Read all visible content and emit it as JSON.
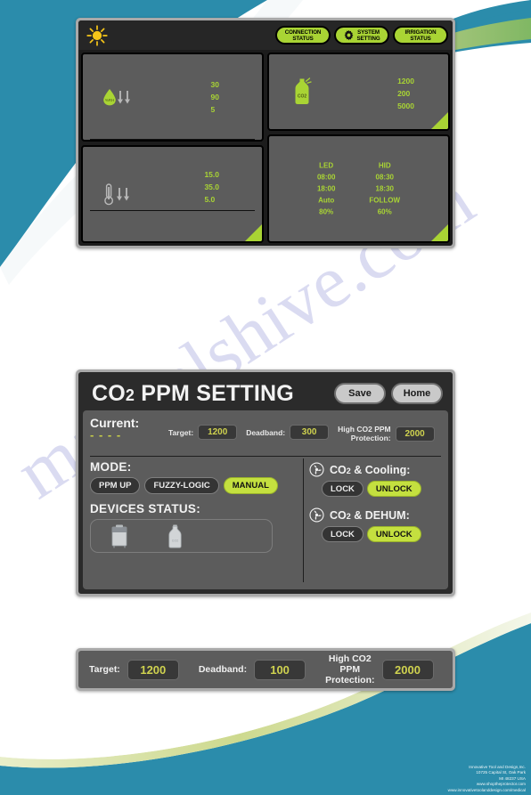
{
  "theme": {
    "teal": "#2b8cab",
    "accent_green": "#a9d434",
    "panel_grey": "#5c5c5c",
    "bezel_grey": "#a9a9a9",
    "screen_black": "#1c1c1c",
    "value_yellow": "#cfd24f",
    "sun_yellow": "#f5c518"
  },
  "watermark": {
    "line1": "manualshive.com",
    "line2": "CO2"
  },
  "dashboard": {
    "topbar": {
      "sun_icon": "sun-icon",
      "buttons": [
        {
          "icon": "",
          "label_line1": "CONNECTION",
          "label_line2": "STATUS",
          "name": "connection-status-button"
        },
        {
          "icon": "gear-icon",
          "label_line1": "SYSTEM",
          "label_line2": "SETTING",
          "name": "system-setting-button"
        },
        {
          "icon": "",
          "label_line1": "IRRIGATION",
          "label_line2": "STATUS",
          "name": "irrigation-status-button"
        }
      ]
    },
    "humidity_panel": {
      "icon": "humidity-droplet-icon",
      "values": [
        "30",
        "90",
        "5"
      ]
    },
    "temperature_panel": {
      "icon": "thermometer-icon",
      "values": [
        "15.0",
        "35.0",
        "5.0"
      ]
    },
    "co2_panel": {
      "icon": "co2-spray-bottle-icon",
      "icon_label": "CO2",
      "values": [
        "1200",
        "200",
        "5000"
      ]
    },
    "lighting_panel": {
      "columns": [
        {
          "header": "LED",
          "on_time": "08:00",
          "off_time": "18:00",
          "mode": "Auto",
          "level": "80%"
        },
        {
          "header": "HID",
          "on_time": "08:30",
          "off_time": "18:30",
          "mode": "FOLLOW",
          "level": "60%"
        }
      ]
    }
  },
  "co2_setting": {
    "title_main": "CO",
    "title_sub": "2",
    "title_rest": " PPM SETTING",
    "save_label": "Save",
    "home_label": "Home",
    "current_label": "Current:",
    "current_value": "- - - -",
    "fields": [
      {
        "label": "Target:",
        "value": "1200",
        "name": "target-field"
      },
      {
        "label": "Deadband:",
        "value": "300",
        "name": "deadband-field"
      },
      {
        "label_line1": "High CO2 PPM",
        "label_line2": "Protection:",
        "value": "2000",
        "name": "high-co2-protection-field"
      }
    ],
    "mode_label": "MODE:",
    "modes": [
      {
        "label": "PPM UP",
        "active": false,
        "name": "mode-ppm-up-button"
      },
      {
        "label": "FUZZY-LOGIC",
        "active": false,
        "name": "mode-fuzzy-logic-button"
      },
      {
        "label": "MANUAL",
        "active": true,
        "name": "mode-manual-button"
      }
    ],
    "devices_label": "DEVICES  STATUS:",
    "devices": [
      {
        "icon": "co2-burner-icon",
        "name": "device-status-burner"
      },
      {
        "icon": "co2-tank-icon",
        "name": "device-status-tank"
      }
    ],
    "controls": [
      {
        "icon": "fan-icon",
        "title_main": "CO",
        "title_sub": "2",
        "title_rest": " & Cooling:",
        "lock_label": "LOCK",
        "unlock_label": "UNLOCK",
        "state": "UNLOCK",
        "name": "co2-cooling-control"
      },
      {
        "icon": "fan-icon",
        "title_main": "CO",
        "title_sub": "2",
        "title_rest": " & DEHUM:",
        "lock_label": "LOCK",
        "unlock_label": "UNLOCK",
        "state": "UNLOCK",
        "name": "co2-dehum-control"
      }
    ]
  },
  "bottom_strip": {
    "fields": [
      {
        "label": "Target:",
        "value": "1200",
        "name": "strip-target-field"
      },
      {
        "label": "Deadband:",
        "value": "100",
        "name": "strip-deadband-field"
      },
      {
        "label_line1": "High CO2 PPM",
        "label_line2": "Protection:",
        "value": "2000",
        "name": "strip-high-co2-protection-field"
      }
    ]
  },
  "footer": {
    "line1": "Innovative Tool and Design,Inc.",
    "line2": "10725 Capital St, Oak Park",
    "line3": "MI 48237 USA",
    "line4": "www.shoptheprotector.com",
    "line5": "www.innovativetoolanddesign.com/medical"
  }
}
